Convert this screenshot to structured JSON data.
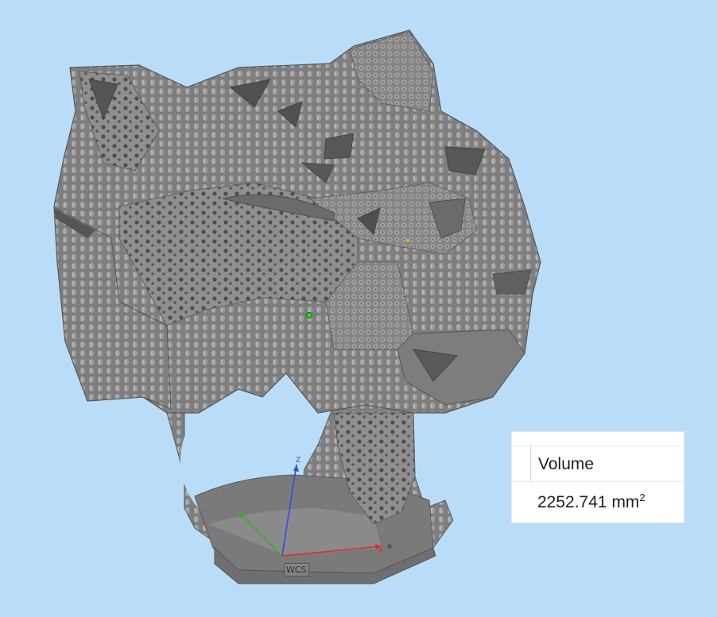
{
  "viewport": {
    "model": "panther-head-ring",
    "coordinate_system_label": "WCS",
    "axes": {
      "x": "X",
      "y": "Y",
      "z": "Z"
    }
  },
  "measurement_panel": {
    "header": "Volume",
    "value": "2252.741",
    "unit": "mm",
    "unit_exponent": "2"
  },
  "colors": {
    "background": "#b9ddf9",
    "model": "#8c8c8c",
    "axis_x": "#e0282d",
    "axis_y": "#34b028",
    "axis_z": "#2e4ee0"
  }
}
